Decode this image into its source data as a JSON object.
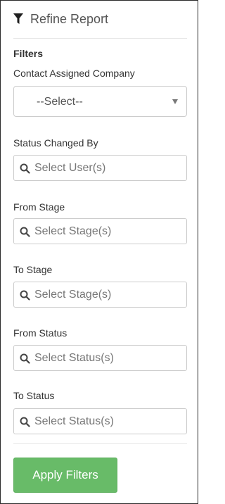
{
  "header": {
    "title": "Refine Report",
    "icon": "filter-icon"
  },
  "filters": {
    "section_title": "Filters",
    "contact_company": {
      "label": "Contact Assigned Company",
      "value": "--Select--"
    },
    "status_changed_by": {
      "label": "Status Changed By",
      "placeholder": "Select User(s)"
    },
    "from_stage": {
      "label": "From Stage",
      "placeholder": "Select Stage(s)"
    },
    "to_stage": {
      "label": "To Stage",
      "placeholder": "Select Stage(s)"
    },
    "from_status": {
      "label": "From Status",
      "placeholder": "Select Status(s)"
    },
    "to_status": {
      "label": "To Status",
      "placeholder": "Select Status(s)"
    }
  },
  "actions": {
    "apply_label": "Apply Filters"
  },
  "colors": {
    "accent_green": "#68bb68",
    "border": "#cccccc"
  }
}
